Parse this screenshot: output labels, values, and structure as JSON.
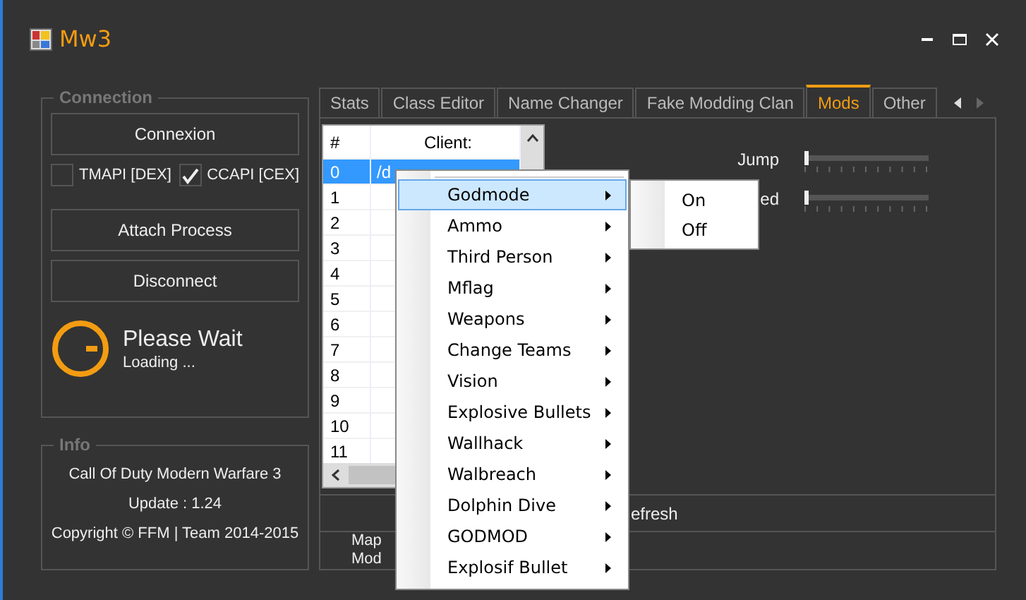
{
  "window": {
    "title": "Mw3"
  },
  "connection": {
    "title": "Connection",
    "connect_button": "Connexion",
    "checkboxes": [
      {
        "label": "TMAPI [DEX]",
        "checked": false
      },
      {
        "label": "CCAPI [CEX]",
        "checked": true
      }
    ],
    "buttons": [
      "Attach Process",
      "Disconnect"
    ],
    "status": {
      "title": "Please Wait",
      "subtitle": "Loading ..."
    }
  },
  "info": {
    "title": "Info",
    "lines": [
      "Call Of Duty Modern Warfare 3",
      "Update : 1.24",
      "Copyright © FFM | Team 2014-2015"
    ]
  },
  "tabs": [
    {
      "label": "Stats",
      "selected": false
    },
    {
      "label": "Class Editor",
      "selected": false
    },
    {
      "label": "Name Changer",
      "selected": false
    },
    {
      "label": "Fake Modding Clan",
      "selected": false
    },
    {
      "label": "Mods",
      "selected": true
    },
    {
      "label": "Other",
      "selected": false
    }
  ],
  "client_list": {
    "columns": [
      "#",
      "Client:"
    ],
    "rows": [
      {
        "index": "0",
        "client": "/d",
        "selected": true
      },
      {
        "index": "1",
        "selected": false
      },
      {
        "index": "2",
        "selected": false
      },
      {
        "index": "3",
        "selected": false
      },
      {
        "index": "4",
        "selected": false
      },
      {
        "index": "5",
        "selected": false
      },
      {
        "index": "6",
        "selected": false
      },
      {
        "index": "7",
        "selected": false
      },
      {
        "index": "8",
        "selected": false
      },
      {
        "index": "9",
        "selected": false
      },
      {
        "index": "10",
        "selected": false
      },
      {
        "index": "11",
        "selected": false
      }
    ]
  },
  "sliders": [
    {
      "label": "Jump",
      "level": 0
    },
    {
      "label": "ed",
      "level": 0
    }
  ],
  "bottom_panels": {
    "refresh_label": "efresh",
    "map_labels": [
      "Map",
      "Mod"
    ]
  },
  "context_menu": {
    "items": [
      {
        "label": "Godmode",
        "selected": true
      },
      {
        "label": "Ammo",
        "selected": false
      },
      {
        "label": "Third Person",
        "selected": false
      },
      {
        "label": "Mflag",
        "selected": false
      },
      {
        "label": "Weapons",
        "selected": false
      },
      {
        "label": "Change Teams",
        "selected": false
      },
      {
        "label": "Vision",
        "selected": false
      },
      {
        "label": "Explosive Bullets",
        "selected": false
      },
      {
        "label": "Wallhack",
        "selected": false
      },
      {
        "label": "Walbreach",
        "selected": false
      },
      {
        "label": "Dolphin Dive",
        "selected": false
      },
      {
        "label": "GODMOD",
        "selected": false
      },
      {
        "label": "Explosif Bullet",
        "selected": false
      }
    ]
  },
  "submenu": {
    "items": [
      "On",
      "Off"
    ]
  }
}
